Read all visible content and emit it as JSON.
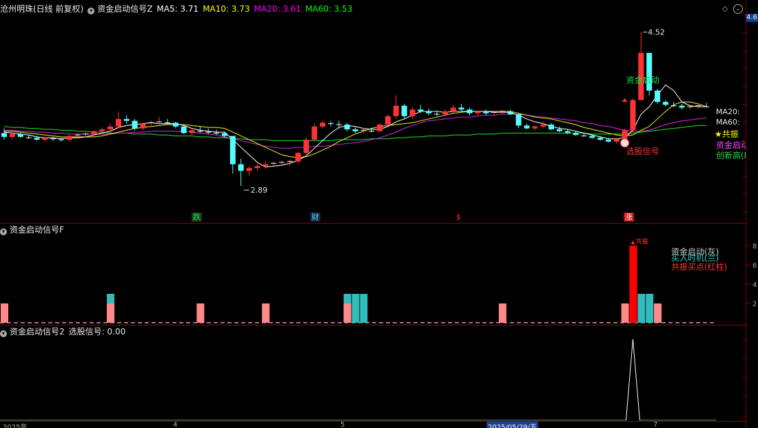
{
  "main_panel": {
    "title": "沧州明珠(日线 前复权)",
    "indicator": "资金启动信号Z",
    "ma_values": [
      {
        "label": "MA5: 3.71",
        "color": "#ffffff"
      },
      {
        "label": "MA10: 3.73",
        "color": "#ffff00"
      },
      {
        "label": "MA20: 3.61",
        "color": "#ff00ff"
      },
      {
        "label": "MA60: 3.53",
        "color": "#00ff00"
      }
    ],
    "current_price_tag": "4.6",
    "annotations": {
      "high": "4.52",
      "low": "2.89",
      "signal_label": "选股信号",
      "start_label": "资金启动",
      "right_ma20": "MA20:",
      "right_ma60": "MA60:",
      "right_gongzhen": "★共振",
      "right_zjqd": "资金启动",
      "right_cxg": "创新高(I"
    },
    "event_marks": [
      {
        "text": "跌",
        "color": "#22dd44",
        "bg": "#1a3d1a"
      },
      {
        "text": "财",
        "color": "#66ccff",
        "bg": "#102a44"
      },
      {
        "text": "$",
        "color": "#ff3333",
        "bg": "#000000"
      },
      {
        "text": "涨",
        "color": "#ffffff",
        "bg": "#cc1111"
      }
    ]
  },
  "sub_panel_1": {
    "title": "资金启动信号F",
    "legend": [
      {
        "label": "资金启动(灰)",
        "color": "#cccccc"
      },
      {
        "label": "买入时机(兰)",
        "color": "#33cccc"
      },
      {
        "label": "共振买点(红柱)",
        "color": "#ff3333"
      }
    ],
    "peak_label": "共振",
    "axis_ticks": [
      "8",
      "6",
      "4",
      "2"
    ]
  },
  "sub_panel_2": {
    "title": "资金启动信号2",
    "value_label": "选股信号: 0.00"
  },
  "x_axis": {
    "labels": [
      "2025年",
      "4",
      "5",
      "2025/05/29/五",
      "7"
    ]
  },
  "chart_data": {
    "type": "candlestick",
    "candles": [
      [
        3.45,
        3.5,
        3.38,
        3.41
      ],
      [
        3.41,
        3.46,
        3.38,
        3.44
      ],
      [
        3.44,
        3.45,
        3.4,
        3.41
      ],
      [
        3.41,
        3.43,
        3.39,
        3.4
      ],
      [
        3.4,
        3.42,
        3.37,
        3.38
      ],
      [
        3.38,
        3.41,
        3.36,
        3.4
      ],
      [
        3.4,
        3.41,
        3.37,
        3.39
      ],
      [
        3.39,
        3.4,
        3.36,
        3.38
      ],
      [
        3.38,
        3.43,
        3.36,
        3.42
      ],
      [
        3.42,
        3.45,
        3.4,
        3.43
      ],
      [
        3.43,
        3.46,
        3.41,
        3.44
      ],
      [
        3.44,
        3.48,
        3.42,
        3.47
      ],
      [
        3.47,
        3.51,
        3.44,
        3.49
      ],
      [
        3.49,
        3.55,
        3.46,
        3.52
      ],
      [
        3.52,
        3.68,
        3.5,
        3.6
      ],
      [
        3.6,
        3.64,
        3.55,
        3.58
      ],
      [
        3.58,
        3.6,
        3.48,
        3.5
      ],
      [
        3.5,
        3.56,
        3.48,
        3.55
      ],
      [
        3.55,
        3.58,
        3.53,
        3.56
      ],
      [
        3.56,
        3.62,
        3.54,
        3.57
      ],
      [
        3.57,
        3.6,
        3.55,
        3.56
      ],
      [
        3.56,
        3.57,
        3.5,
        3.52
      ],
      [
        3.52,
        3.53,
        3.44,
        3.45
      ],
      [
        3.45,
        3.5,
        3.43,
        3.48
      ],
      [
        3.48,
        3.52,
        3.45,
        3.47
      ],
      [
        3.47,
        3.5,
        3.44,
        3.46
      ],
      [
        3.46,
        3.49,
        3.43,
        3.45
      ],
      [
        3.45,
        3.47,
        3.4,
        3.42
      ],
      [
        3.42,
        3.42,
        3.02,
        3.12
      ],
      [
        3.12,
        3.18,
        2.89,
        3.05
      ],
      [
        3.05,
        3.1,
        3.0,
        3.08
      ],
      [
        3.08,
        3.12,
        3.05,
        3.1
      ],
      [
        3.1,
        3.15,
        3.07,
        3.12
      ],
      [
        3.12,
        3.15,
        3.09,
        3.13
      ],
      [
        3.13,
        3.16,
        3.1,
        3.14
      ],
      [
        3.14,
        3.17,
        3.1,
        3.15
      ],
      [
        3.15,
        3.25,
        3.13,
        3.24
      ],
      [
        3.24,
        3.4,
        3.22,
        3.38
      ],
      [
        3.38,
        3.55,
        3.36,
        3.52
      ],
      [
        3.52,
        3.58,
        3.5,
        3.56
      ],
      [
        3.56,
        3.58,
        3.52,
        3.55
      ],
      [
        3.55,
        3.58,
        3.5,
        3.54
      ],
      [
        3.54,
        3.56,
        3.47,
        3.49
      ],
      [
        3.49,
        3.51,
        3.45,
        3.47
      ],
      [
        3.47,
        3.5,
        3.45,
        3.48
      ],
      [
        3.48,
        3.5,
        3.46,
        3.47
      ],
      [
        3.47,
        3.55,
        3.46,
        3.54
      ],
      [
        3.54,
        3.65,
        3.52,
        3.63
      ],
      [
        3.63,
        3.85,
        3.6,
        3.74
      ],
      [
        3.74,
        3.76,
        3.6,
        3.63
      ],
      [
        3.63,
        3.72,
        3.6,
        3.7
      ],
      [
        3.7,
        3.75,
        3.66,
        3.68
      ],
      [
        3.68,
        3.71,
        3.64,
        3.66
      ],
      [
        3.66,
        3.69,
        3.63,
        3.65
      ],
      [
        3.65,
        3.7,
        3.63,
        3.68
      ],
      [
        3.68,
        3.75,
        3.66,
        3.72
      ],
      [
        3.72,
        3.76,
        3.68,
        3.7
      ],
      [
        3.7,
        3.72,
        3.64,
        3.66
      ],
      [
        3.66,
        3.69,
        3.63,
        3.68
      ],
      [
        3.68,
        3.7,
        3.64,
        3.66
      ],
      [
        3.66,
        3.69,
        3.64,
        3.67
      ],
      [
        3.67,
        3.7,
        3.65,
        3.68
      ],
      [
        3.68,
        3.7,
        3.64,
        3.65
      ],
      [
        3.65,
        3.66,
        3.5,
        3.53
      ],
      [
        3.53,
        3.55,
        3.49,
        3.5
      ],
      [
        3.5,
        3.53,
        3.48,
        3.52
      ],
      [
        3.52,
        3.57,
        3.5,
        3.54
      ],
      [
        3.54,
        3.56,
        3.48,
        3.49
      ],
      [
        3.49,
        3.52,
        3.46,
        3.47
      ],
      [
        3.47,
        3.49,
        3.44,
        3.45
      ],
      [
        3.45,
        3.47,
        3.42,
        3.43
      ],
      [
        3.43,
        3.45,
        3.41,
        3.42
      ],
      [
        3.42,
        3.44,
        3.39,
        3.4
      ],
      [
        3.4,
        3.42,
        3.37,
        3.38
      ],
      [
        3.38,
        3.4,
        3.35,
        3.36
      ],
      [
        3.36,
        3.4,
        3.34,
        3.39
      ],
      [
        3.39,
        3.5,
        3.38,
        3.48
      ],
      [
        3.48,
        3.82,
        3.46,
        3.8
      ],
      [
        3.8,
        4.52,
        3.82,
        4.3
      ],
      [
        4.3,
        4.1,
        3.85,
        3.9
      ],
      [
        3.9,
        3.92,
        3.76,
        3.78
      ],
      [
        3.78,
        3.8,
        3.73,
        3.75
      ],
      [
        3.75,
        3.78,
        3.72,
        3.74
      ],
      [
        3.74,
        3.76,
        3.7,
        3.72
      ],
      [
        3.72,
        3.75,
        3.7,
        3.73
      ],
      [
        3.73,
        3.76,
        3.71,
        3.74
      ],
      [
        3.74,
        3.77,
        3.72,
        3.73
      ]
    ],
    "ma5": [
      3.46,
      3.45,
      3.44,
      3.43,
      3.41,
      3.4,
      3.4,
      3.39,
      3.4,
      3.4,
      3.41,
      3.43,
      3.45,
      3.47,
      3.51,
      3.53,
      3.54,
      3.55,
      3.56,
      3.55,
      3.55,
      3.55,
      3.53,
      3.5,
      3.48,
      3.47,
      3.46,
      3.46,
      3.38,
      3.3,
      3.22,
      3.14,
      3.09,
      3.1,
      3.11,
      3.13,
      3.16,
      3.21,
      3.29,
      3.37,
      3.45,
      3.51,
      3.53,
      3.52,
      3.5,
      3.49,
      3.49,
      3.52,
      3.57,
      3.6,
      3.64,
      3.68,
      3.68,
      3.68,
      3.67,
      3.68,
      3.68,
      3.68,
      3.68,
      3.68,
      3.67,
      3.67,
      3.67,
      3.64,
      3.6,
      3.57,
      3.55,
      3.52,
      3.5,
      3.49,
      3.47,
      3.45,
      3.43,
      3.41,
      3.39,
      3.39,
      3.4,
      3.48,
      3.65,
      3.73,
      3.85,
      3.96,
      3.9,
      3.78,
      3.74,
      3.73,
      3.73
    ],
    "ma10": [
      3.47,
      3.47,
      3.46,
      3.45,
      3.44,
      3.43,
      3.42,
      3.41,
      3.41,
      3.41,
      3.41,
      3.41,
      3.42,
      3.44,
      3.46,
      3.48,
      3.5,
      3.51,
      3.52,
      3.53,
      3.54,
      3.54,
      3.54,
      3.53,
      3.52,
      3.51,
      3.51,
      3.5,
      3.46,
      3.42,
      3.38,
      3.34,
      3.3,
      3.26,
      3.22,
      3.2,
      3.19,
      3.2,
      3.23,
      3.27,
      3.31,
      3.36,
      3.4,
      3.44,
      3.47,
      3.5,
      3.52,
      3.53,
      3.54,
      3.55,
      3.56,
      3.58,
      3.6,
      3.62,
      3.64,
      3.66,
      3.67,
      3.68,
      3.68,
      3.68,
      3.68,
      3.68,
      3.68,
      3.66,
      3.64,
      3.62,
      3.61,
      3.6,
      3.58,
      3.56,
      3.54,
      3.51,
      3.49,
      3.47,
      3.45,
      3.43,
      3.42,
      3.43,
      3.48,
      3.52,
      3.6,
      3.68,
      3.75,
      3.78,
      3.78,
      3.76,
      3.73
    ],
    "ma20": [
      3.48,
      3.48,
      3.47,
      3.47,
      3.46,
      3.46,
      3.45,
      3.45,
      3.44,
      3.44,
      3.44,
      3.44,
      3.44,
      3.44,
      3.45,
      3.45,
      3.46,
      3.46,
      3.47,
      3.47,
      3.47,
      3.47,
      3.47,
      3.46,
      3.45,
      3.44,
      3.43,
      3.41,
      3.39,
      3.37,
      3.35,
      3.33,
      3.31,
      3.3,
      3.29,
      3.29,
      3.3,
      3.3,
      3.31,
      3.31,
      3.32,
      3.33,
      3.34,
      3.35,
      3.36,
      3.38,
      3.4,
      3.43,
      3.46,
      3.5,
      3.53,
      3.56,
      3.58,
      3.59,
      3.6,
      3.61,
      3.62,
      3.62,
      3.63,
      3.64,
      3.64,
      3.65,
      3.65,
      3.65,
      3.64,
      3.63,
      3.62,
      3.61,
      3.6,
      3.59,
      3.58,
      3.56,
      3.55,
      3.53,
      3.52,
      3.5,
      3.48,
      3.47,
      3.47,
      3.48,
      3.51,
      3.54,
      3.56,
      3.58,
      3.59,
      3.6,
      3.61
    ],
    "ma60": [
      3.52,
      3.51,
      3.51,
      3.5,
      3.5,
      3.49,
      3.49,
      3.48,
      3.48,
      3.47,
      3.47,
      3.46,
      3.46,
      3.45,
      3.45,
      3.45,
      3.44,
      3.44,
      3.44,
      3.43,
      3.43,
      3.42,
      3.42,
      3.42,
      3.41,
      3.41,
      3.4,
      3.4,
      3.39,
      3.39,
      3.38,
      3.38,
      3.38,
      3.37,
      3.37,
      3.37,
      3.37,
      3.37,
      3.37,
      3.37,
      3.37,
      3.38,
      3.38,
      3.38,
      3.38,
      3.39,
      3.39,
      3.39,
      3.4,
      3.4,
      3.41,
      3.41,
      3.42,
      3.42,
      3.42,
      3.43,
      3.43,
      3.43,
      3.44,
      3.44,
      3.44,
      3.45,
      3.45,
      3.45,
      3.45,
      3.45,
      3.45,
      3.45,
      3.45,
      3.45,
      3.45,
      3.45,
      3.44,
      3.44,
      3.44,
      3.44,
      3.44,
      3.45,
      3.46,
      3.47,
      3.48,
      3.49,
      3.5,
      3.51,
      3.52,
      3.53,
      3.53
    ],
    "sub1_bars": [
      {
        "i": 0,
        "v": 2,
        "c": "pink"
      },
      {
        "i": 13,
        "v": 2,
        "c": "pink"
      },
      {
        "i": 13,
        "v": 3,
        "c": "cyan"
      },
      {
        "i": 24,
        "v": 2,
        "c": "pink"
      },
      {
        "i": 32,
        "v": 2,
        "c": "pink"
      },
      {
        "i": 42,
        "v": 2,
        "c": "pink"
      },
      {
        "i": 42,
        "v": 3,
        "c": "cyan"
      },
      {
        "i": 43,
        "v": 3,
        "c": "cyan"
      },
      {
        "i": 44,
        "v": 3,
        "c": "cyan"
      },
      {
        "i": 61,
        "v": 2,
        "c": "pink"
      },
      {
        "i": 76,
        "v": 2,
        "c": "pink"
      },
      {
        "i": 77,
        "v": 8,
        "c": "red"
      },
      {
        "i": 78,
        "v": 3,
        "c": "cyan"
      },
      {
        "i": 79,
        "v": 3,
        "c": "cyan"
      },
      {
        "i": 80,
        "v": 2,
        "c": "pink"
      }
    ],
    "sub2_spike_index": 77,
    "ylim": [
      2.6,
      4.7
    ]
  }
}
